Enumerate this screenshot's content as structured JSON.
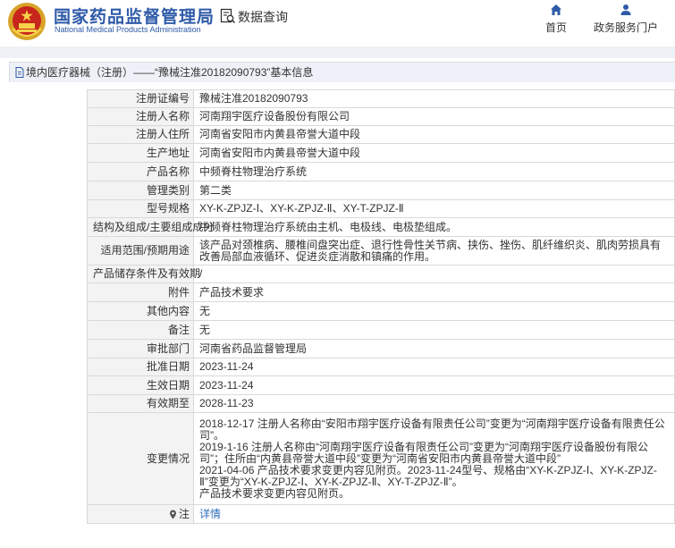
{
  "header": {
    "logo_cn": "国家药品监督管理局",
    "logo_en": "National Medical Products Administration",
    "query_title": "数据查询",
    "nav": [
      {
        "label": "首页",
        "icon": "home-icon"
      },
      {
        "label": "政务服务门户",
        "icon": "user-icon"
      }
    ]
  },
  "title_bar": {
    "text": "境内医疗器械（注册）——“豫械注准20182090793”基本信息"
  },
  "rows": [
    {
      "label": "注册证编号",
      "value": "豫械注准20182090793"
    },
    {
      "label": "注册人名称",
      "value": "河南翔宇医疗设备股份有限公司"
    },
    {
      "label": "注册人住所",
      "value": "河南省安阳市内黄县帝誉大道中段"
    },
    {
      "label": "生产地址",
      "value": "河南省安阳市内黄县帝誉大道中段"
    },
    {
      "label": "产品名称",
      "value": "中频脊柱物理治疗系统"
    },
    {
      "label": "管理类别",
      "value": "第二类"
    },
    {
      "label": "型号规格",
      "value": "XY-K-ZPJZ-Ⅰ、XY-K-ZPJZ-Ⅱ、XY-T-ZPJZ-Ⅱ"
    },
    {
      "label": "结构及组成/主要组成成分",
      "value": "中频脊柱物理治疗系统由主机、电极线、电极垫组成。"
    },
    {
      "label": "适用范围/预期用途",
      "value": "该产品对颈椎病、腰椎间盘突出症、退行性骨性关节病、挟伤、挫伤、肌纤维织炎、肌肉劳损具有改善局部血液循环、促进炎症消散和镇痛的作用。"
    },
    {
      "label": "产品储存条件及有效期",
      "value": "/"
    },
    {
      "label": "附件",
      "value": "产品技术要求"
    },
    {
      "label": "其他内容",
      "value": "无"
    },
    {
      "label": "备注",
      "value": "无"
    },
    {
      "label": "审批部门",
      "value": "河南省药品监督管理局"
    },
    {
      "label": "批准日期",
      "value": "2023-11-24"
    },
    {
      "label": "生效日期",
      "value": "2023-11-24"
    },
    {
      "label": "有效期至",
      "value": "2028-11-23"
    }
  ],
  "changes": {
    "label": "变更情况",
    "lines": [
      "2018-12-17 注册人名称由“安阳市翔宇医疗设备有限责任公司”变更为“河南翔宇医疗设备有限责任公司”。",
      "2019-1-16 注册人名称由“河南翔宇医疗设备有限责任公司”变更为“河南翔宇医疗设备股份有限公司”；住所由“内黄县帝誉大道中段”变更为“河南省安阳市内黄县帝誉大道中段”",
      "2021-04-06 产品技术要求变更内容见附页。2023-11-24型号、规格由“XY-K-ZPJZ-Ⅰ、XY-K-ZPJZ-Ⅱ”变更为“XY-K-ZPJZ-Ⅰ、XY-K-ZPJZ-Ⅱ、XY-T-ZPJZ-Ⅱ”。",
      "产品技术要求变更内容见附页。"
    ]
  },
  "note_row": {
    "label": "注",
    "link": "详情"
  }
}
